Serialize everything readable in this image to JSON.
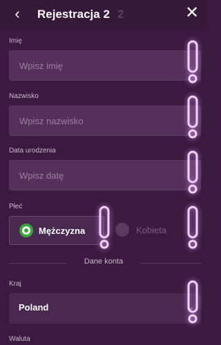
{
  "header": {
    "back_icon": "‹",
    "title": "Rejestracja 2",
    "title_ghost": "2",
    "close_icon": "✕"
  },
  "form": {
    "first_name": {
      "label": "Imię",
      "placeholder": "Wpisz imię"
    },
    "last_name": {
      "label": "Nazwisko",
      "placeholder": "Wpisz nazwisko"
    },
    "birth_date": {
      "label": "Data urodzenia",
      "placeholder": "Wpisz datę"
    },
    "gender": {
      "label": "Płeć",
      "options": [
        {
          "label": "Mężczyzna",
          "selected": true
        },
        {
          "label": "Kobieta",
          "selected": false
        }
      ]
    },
    "section_title": "Dane konta",
    "country": {
      "label": "Kraj",
      "value": "Poland"
    },
    "currency": {
      "label": "Waluta"
    }
  },
  "colors": {
    "background": "#3a1a3e",
    "field": "#55305a",
    "radio_selected": "#3aa63a",
    "warning_glow": "#f4d2ff"
  },
  "icons": [
    "chevron-left-icon",
    "close-icon",
    "chevron-down-icon",
    "exclamation-warning-icon"
  ]
}
